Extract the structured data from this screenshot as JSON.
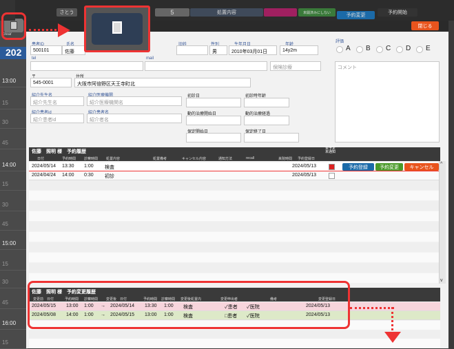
{
  "topbar": {
    "tabs": [
      "さとう",
      "5",
      "処置内容",
      "未開済みにしない",
      "予約変更",
      "予約開始"
    ]
  },
  "left": {
    "clear": "clear",
    "year": "202",
    "times": [
      {
        "t": "13:00",
        "s": false
      },
      {
        "t": "15",
        "s": true
      },
      {
        "t": "30",
        "s": true
      },
      {
        "t": "45",
        "s": true
      },
      {
        "t": "14:00",
        "s": false
      },
      {
        "t": "15",
        "s": true
      },
      {
        "t": "30",
        "s": true
      },
      {
        "t": "45",
        "s": true
      },
      {
        "t": "15:00",
        "s": false
      },
      {
        "t": "15",
        "s": true
      },
      {
        "t": "30",
        "s": true
      },
      {
        "t": "45",
        "s": true
      },
      {
        "t": "16:00",
        "s": false
      },
      {
        "t": "15",
        "s": true
      }
    ]
  },
  "close_label": "閉じる",
  "form": {
    "patient_id_label": "患者ID",
    "patient_id": "500101",
    "name_label": "氏名",
    "name": "佐藤",
    "kana_label": "旧姓",
    "sex_label": "性別",
    "sex": "男",
    "birth_label": "生年月日",
    "birth": "2010年03月01日",
    "age_label": "年齢",
    "age": "14y2m",
    "eval_label": "評価",
    "eval_options": [
      "A",
      "B",
      "C",
      "D",
      "E"
    ],
    "tel_label": "tel",
    "mail_label": "mail",
    "insurance_placeholder": "保険診療",
    "comment_placeholder": "コメント",
    "zip_label": "〒",
    "zip": "545-0001",
    "addr_label": "住所",
    "addr": "大阪市阿倍野区天王寺町北",
    "ref_doctor_label": "紹介先生名",
    "ref_doctor_ph": "紹介先生名",
    "ref_inst_label": "紹介医療機関",
    "ref_inst_ph": "紹介医療機関名",
    "first_visit_label": "初診日",
    "first_visit_age_label": "初診時年齢",
    "ref_patient_id_label": "紹介患者id",
    "ref_patient_id_ph": "紹介患者id",
    "ref_patient_name_label": "紹介患者名",
    "ref_patient_name_ph": "紹介者名",
    "tx_start_label": "動的治療開始日",
    "tx_elapsed_label": "動的治療経過",
    "retain_start_label": "保定開始日",
    "retain_end_label": "保定終了日"
  },
  "history": {
    "title": "佐藤　照明 様　予約履歴",
    "unsent_label": "未予定\n未通知",
    "headers": [
      "日付",
      "予約時間",
      "診察時間",
      "処置内容",
      "処置備考",
      "キャンセル内容",
      "通知方法",
      "recall",
      "来院時間",
      "予約登録日"
    ],
    "rows": [
      {
        "date": "2024/05/14",
        "time": "13:30",
        "dur": "1:00",
        "proc": "検査",
        "reg": "2024/05/13"
      },
      {
        "date": "2024/04/24",
        "time": "14:00",
        "dur": "0:30",
        "proc": "初診",
        "reg": "2024/05/13"
      }
    ],
    "buttons": {
      "register": "予約登録",
      "change": "予約変更",
      "cancel": "キャンセル"
    }
  },
  "changes": {
    "title": "佐藤　照明 様　予約変更履歴",
    "headers": [
      "変更前　日付",
      "予約時間",
      "診察時間",
      "変更後　日付",
      "予約時間",
      "診察時間",
      "変更後処置内",
      "変更申出者",
      "備考",
      "変更登録日"
    ],
    "rows": [
      {
        "from_date": "2024/05/15",
        "from_time": "13:00",
        "from_dur": "1:00",
        "arrow": "→",
        "to_date": "2024/05/14",
        "to_time": "13:30",
        "to_dur": "1:00",
        "proc": "検査",
        "patient_chk": "✓患者",
        "clinic_chk": "✓医院",
        "reg": "2024/05/13",
        "color": "#f7d5dc"
      },
      {
        "from_date": "2024/05/08",
        "from_time": "14:00",
        "from_dur": "1:00",
        "arrow": "→",
        "to_date": "2024/05/15",
        "to_time": "13:00",
        "to_dur": "1:00",
        "proc": "検査",
        "patient_chk": "□患者",
        "clinic_chk": "✓医院",
        "reg": "2024/05/13",
        "color": "#dde9c8"
      }
    ]
  }
}
